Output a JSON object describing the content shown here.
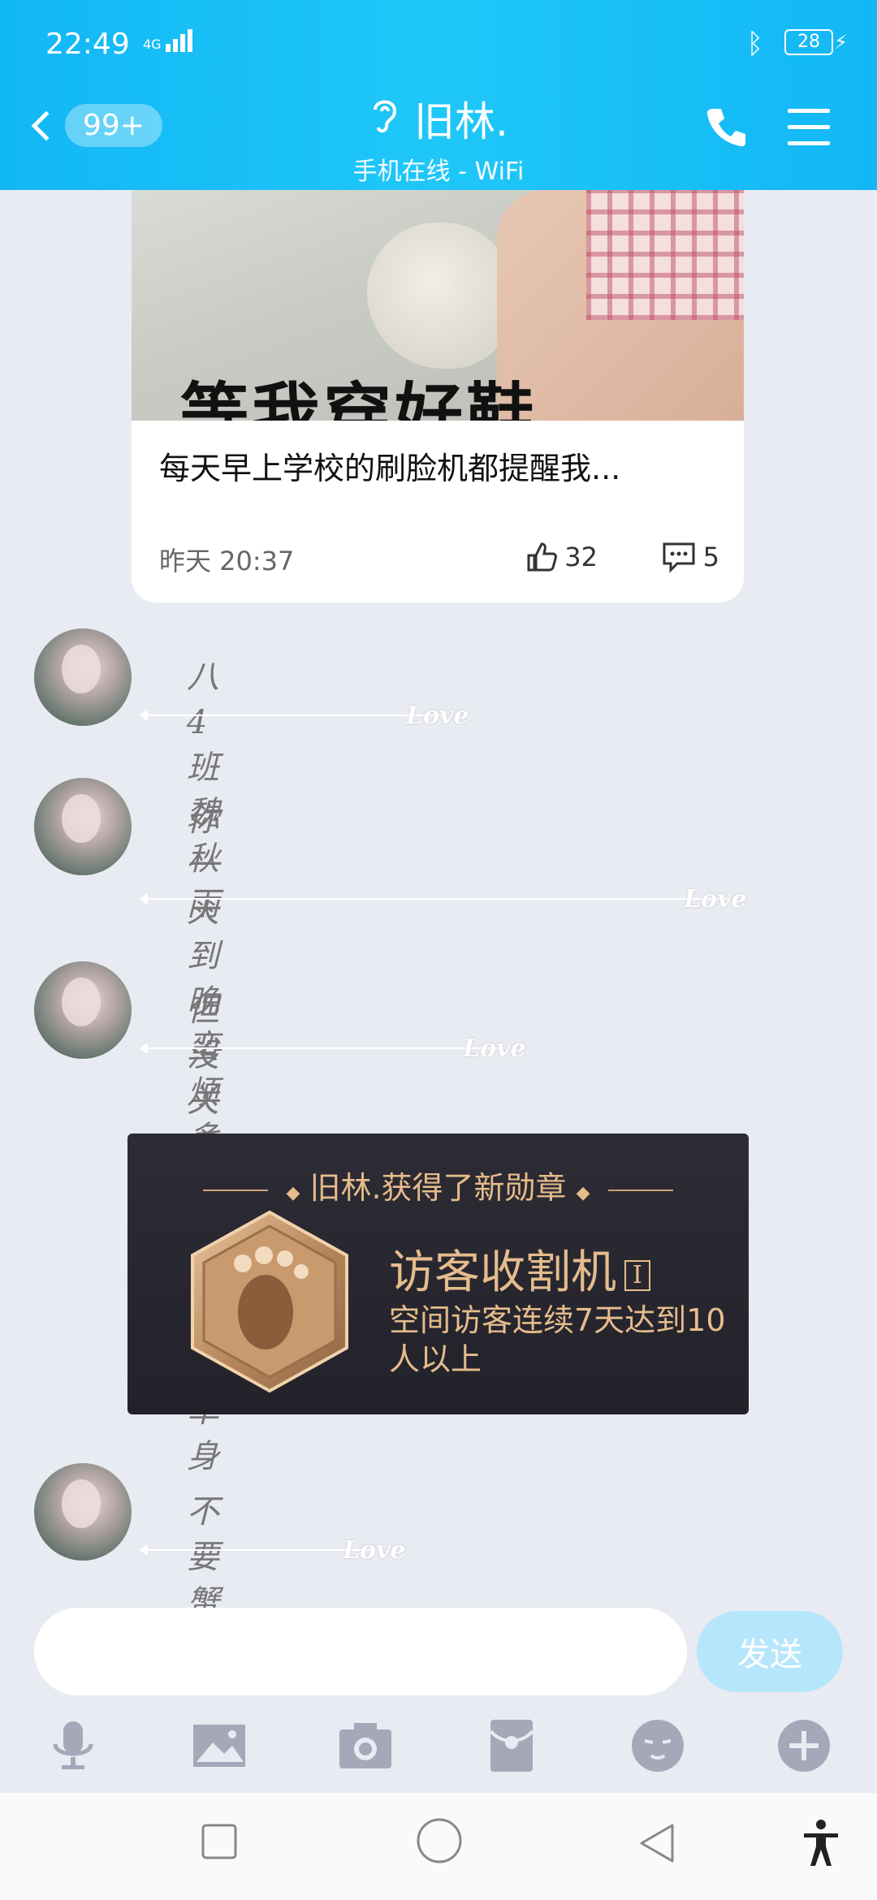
{
  "status_bar": {
    "time": "22:49",
    "network": "4G",
    "battery": "28"
  },
  "header": {
    "back_badge": "99+",
    "title": "旧林.",
    "subtitle": "手机在线 - WiFi"
  },
  "post": {
    "image_caption": "等我穿好鞋",
    "title": "每天早上学校的刷脸机都提醒我...",
    "date": "昨天 20:37",
    "likes": "32",
    "comments": "5"
  },
  "messages": [
    {
      "text": "八4班魏秋雨",
      "tag": "Love"
    },
    {
      "text_line1": "你一天到晚蛮烦多话还是万",
      "text_line2": "年单身",
      "tag": "Love"
    },
    {
      "text": "但没关系我爱你",
      "tag": "Love"
    },
    {
      "text": "不要蟹蟹",
      "tag": "Love"
    }
  ],
  "medal": {
    "headline": "旧林.获得了新勋章",
    "name": "访客收割机",
    "level": "I",
    "description": "空间访客连续7天达到10人以上"
  },
  "composer": {
    "send_label": "发送"
  },
  "colors": {
    "header_blue": "#12b7f5",
    "medal_gold": "#e5bc8c",
    "send_button": "#b6e6fb"
  }
}
